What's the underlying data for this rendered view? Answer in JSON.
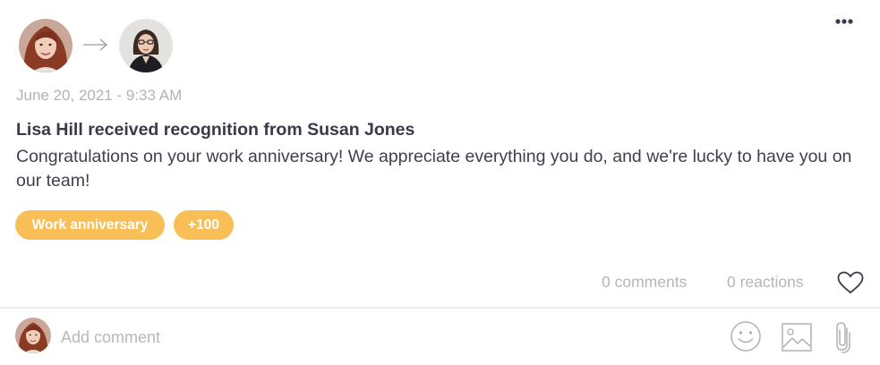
{
  "post": {
    "date": "June 20, 2021 - 9:33 AM",
    "title": "Lisa Hill received recognition from Susan Jones",
    "message": "Congratulations on your work anniversary! We appreciate everything you do, and we're lucky to have you on our team!",
    "badges": [
      {
        "label": "Work anniversary"
      },
      {
        "label": "+100"
      }
    ],
    "badge_color": "#f7bf56"
  },
  "stats": {
    "comments_label": "0 comments",
    "reactions_label": "0 reactions"
  },
  "icons": {
    "more": "more-horizontal-icon",
    "arrow": "arrow-right-icon",
    "heart": "heart-icon",
    "emoji": "smiley-icon",
    "image": "image-icon",
    "attach": "paperclip-icon"
  },
  "comment": {
    "placeholder": "Add comment"
  }
}
